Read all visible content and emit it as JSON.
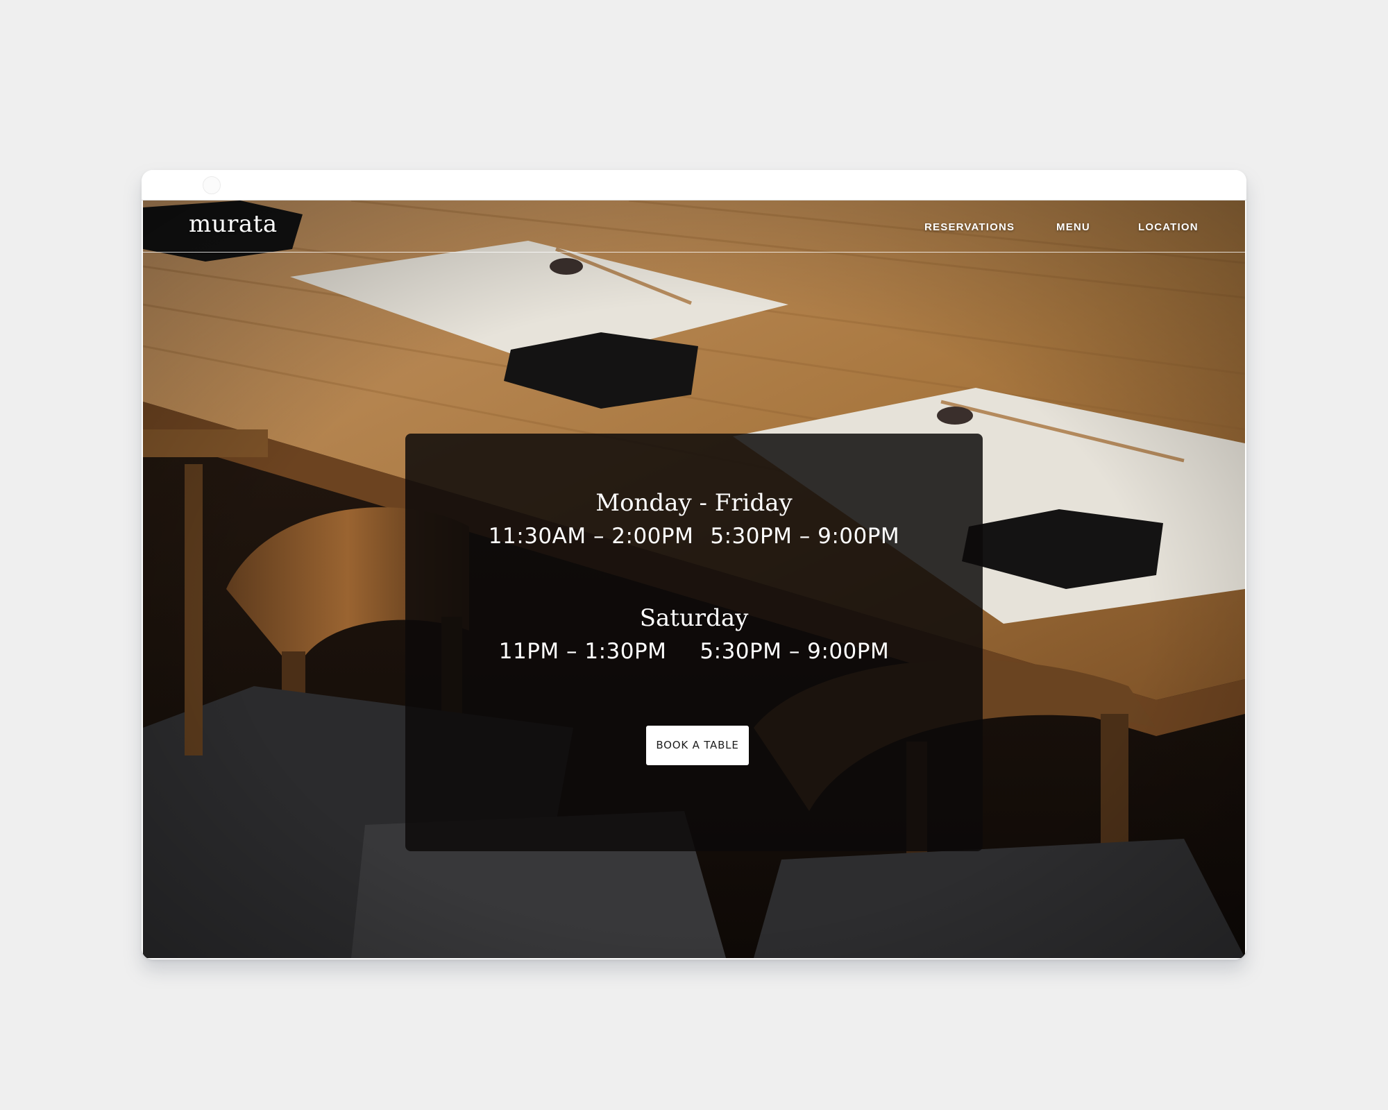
{
  "site": {
    "logo": "murata"
  },
  "nav": {
    "items": [
      {
        "label": "RESERVATIONS"
      },
      {
        "label": "MENU"
      },
      {
        "label": "LOCATION"
      }
    ]
  },
  "hours": {
    "weekday": {
      "heading": "Monday - Friday",
      "lunch": "11:30AM – 2:00PM",
      "dinner": "5:30PM – 9:00PM"
    },
    "saturday": {
      "heading": "Saturday",
      "lunch": "11PM – 1:30PM",
      "dinner": "5:30PM – 9:00PM"
    }
  },
  "cta": {
    "label": "BOOK A TABLE"
  },
  "icons": {
    "browser_control": "circle-icon"
  },
  "colors": {
    "page_background": "#efefef",
    "panel_overlay": "#0c0a09",
    "button_background": "#ffffff",
    "header_text": "#ffffff"
  }
}
